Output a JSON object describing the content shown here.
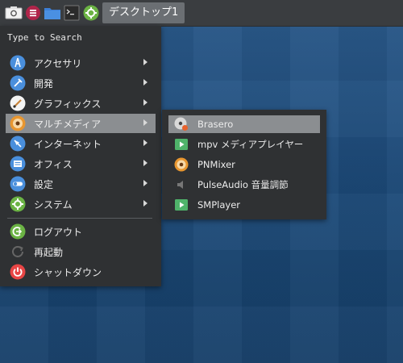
{
  "taskbar": {
    "task_button_label": "デスクトップ1",
    "icons": [
      "menu-system-icon",
      "app-menu-icon",
      "folder-icon",
      "terminal-icon",
      "settings-icon"
    ]
  },
  "main_menu": {
    "search_label": "Type to Search",
    "items": [
      {
        "label": "アクセサリ",
        "icon": "accessories-icon",
        "submenu": true
      },
      {
        "label": "開発",
        "icon": "development-icon",
        "submenu": true
      },
      {
        "label": "グラフィックス",
        "icon": "graphics-icon",
        "submenu": true
      },
      {
        "label": "マルチメディア",
        "icon": "multimedia-icon",
        "submenu": true,
        "active": true
      },
      {
        "label": "インターネット",
        "icon": "internet-icon",
        "submenu": true
      },
      {
        "label": "オフィス",
        "icon": "office-icon",
        "submenu": true
      },
      {
        "label": "設定",
        "icon": "settings-icon",
        "submenu": true
      },
      {
        "label": "システム",
        "icon": "system-icon",
        "submenu": true
      }
    ],
    "session_items": [
      {
        "label": "ログアウト",
        "icon": "logout-icon"
      },
      {
        "label": "再起動",
        "icon": "restart-icon"
      },
      {
        "label": "シャットダウン",
        "icon": "shutdown-icon"
      }
    ]
  },
  "submenu": {
    "items": [
      {
        "label": "Brasero",
        "icon": "brasero-icon",
        "active": true
      },
      {
        "label": "mpv メディアプレイヤー",
        "icon": "mpv-icon"
      },
      {
        "label": "PNMixer",
        "icon": "pnmixer-icon"
      },
      {
        "label": "PulseAudio 音量調節",
        "icon": "volume-icon"
      },
      {
        "label": "SMPlayer",
        "icon": "smplayer-icon"
      }
    ]
  },
  "colors": {
    "menu_bg": "#2f3133",
    "highlight": "#8b8e91",
    "desktop": "#1f4c7c",
    "taskbar": "#3a3d40"
  }
}
